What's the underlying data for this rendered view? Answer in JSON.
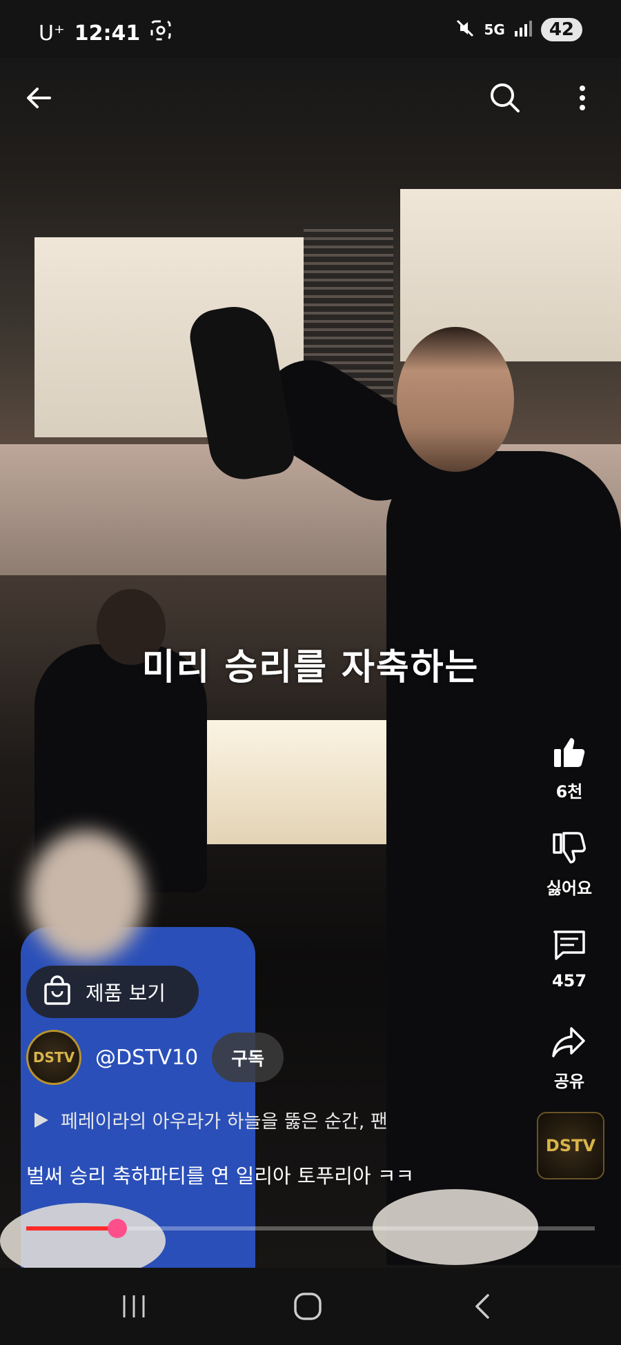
{
  "status": {
    "carrier": "U⁺",
    "time": "12:41",
    "network": "5G",
    "battery": "42"
  },
  "overlay": {
    "caption": "미리 승리를 자축하는",
    "shop_label": "제품 보기",
    "channel_handle": "@DSTV10",
    "subscribe_label": "구독",
    "music_text": "페레이라의 아우라가 하늘을 뚫은 순간, 팬",
    "video_title": "벌써 승리 축하파티를 연 일리아 토푸리아 ㅋㅋ",
    "avatar_text": "DSTV",
    "sound_thumb_text": "DSTV",
    "progress_fraction": 0.16
  },
  "actions": {
    "like": {
      "label": "6천",
      "icon": "thumbs-up-icon"
    },
    "dislike": {
      "label": "싫어요",
      "icon": "thumbs-down-icon"
    },
    "comments": {
      "label": "457",
      "icon": "comment-icon"
    },
    "share": {
      "label": "공유",
      "icon": "share-icon"
    }
  },
  "colors": {
    "progress": "#ff2a2a",
    "progress_knob": "#ff4f8b",
    "avatar_gold": "#d9b54a"
  }
}
